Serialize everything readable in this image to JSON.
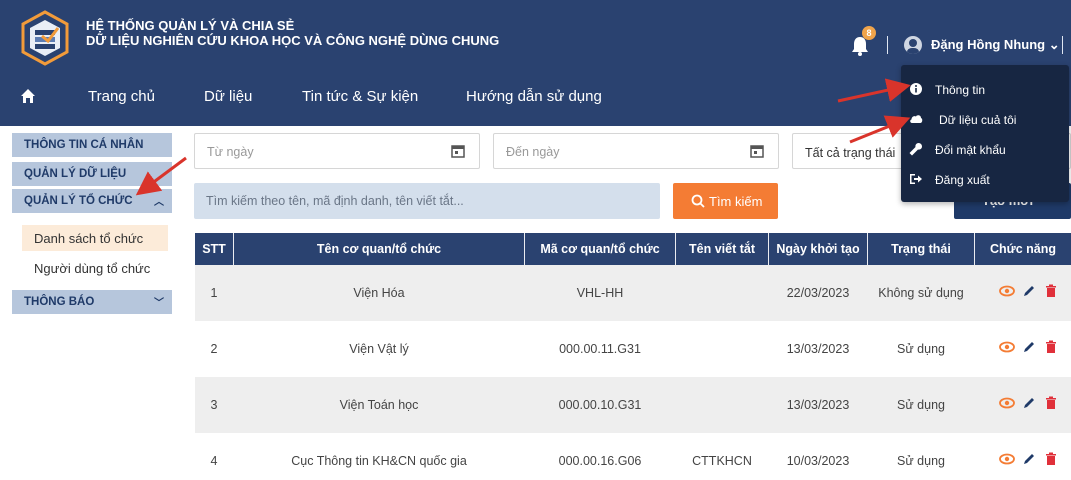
{
  "header": {
    "title_line1": "HỆ THỐNG QUẢN LÝ VÀ CHIA SẺ",
    "title_line2": "DỮ LIỆU NGHIÊN CỨU KHOA HỌC VÀ CÔNG NGHỆ DÙNG CHUNG",
    "notification_count": "8",
    "user_name": "Đặng Hồng Nhung ⌄",
    "nav": [
      "Trang chủ",
      "Dữ liệu",
      "Tin tức & Sự kiện",
      "Hướng dẫn sử dụng"
    ]
  },
  "user_menu": [
    "Thông tin",
    "Dữ liệu cuả tôi",
    "Đổi mật khẩu",
    "Đăng xuất"
  ],
  "sidebar": {
    "groups": [
      "THÔNG TIN CÁ NHÂN",
      "QUẢN LÝ DỮ LIỆU",
      "QUẢN LÝ TỔ CHỨC",
      "THÔNG BÁO"
    ],
    "sub_items": [
      "Danh sách tổ chức",
      "Người dùng tổ chức"
    ],
    "active_sub_item": "Danh sách tổ chức"
  },
  "filters": {
    "from_date_placeholder": "Từ ngày",
    "to_date_placeholder": "Đến ngày",
    "status_value": "Tất cả trạng thái",
    "search_placeholder": "Tìm kiếm theo tên, mã định danh, tên viết tắt...",
    "search_button": "Tìm kiếm",
    "create_button": "Tạo mới"
  },
  "table": {
    "columns": [
      "STT",
      "Tên cơ quan/tổ chức",
      "Mã cơ quan/tổ chức",
      "Tên viết tắt",
      "Ngày khởi tạo",
      "Trạng thái",
      "Chức năng"
    ],
    "rows": [
      [
        "1",
        "Viện Hóa",
        "VHL-HH",
        "",
        "22/03/2023",
        "Không sử dụng"
      ],
      [
        "2",
        "Viện Vật lý",
        "000.00.11.G31",
        "",
        "13/03/2023",
        "Sử dụng"
      ],
      [
        "3",
        "Viện Toán học",
        "000.00.10.G31",
        "",
        "13/03/2023",
        "Sử dụng"
      ],
      [
        "4",
        "Cục Thông tin KH&CN quốc gia",
        "000.00.16.G06",
        "CTTKHCN",
        "10/03/2023",
        "Sử dụng"
      ]
    ]
  },
  "colors": {
    "header_bg": "#2a4270",
    "accent_orange": "#f47c34",
    "dropdown_bg": "#172642",
    "sidebar_group_bg": "#b6c6dc",
    "annotation_red": "#d9342b"
  }
}
